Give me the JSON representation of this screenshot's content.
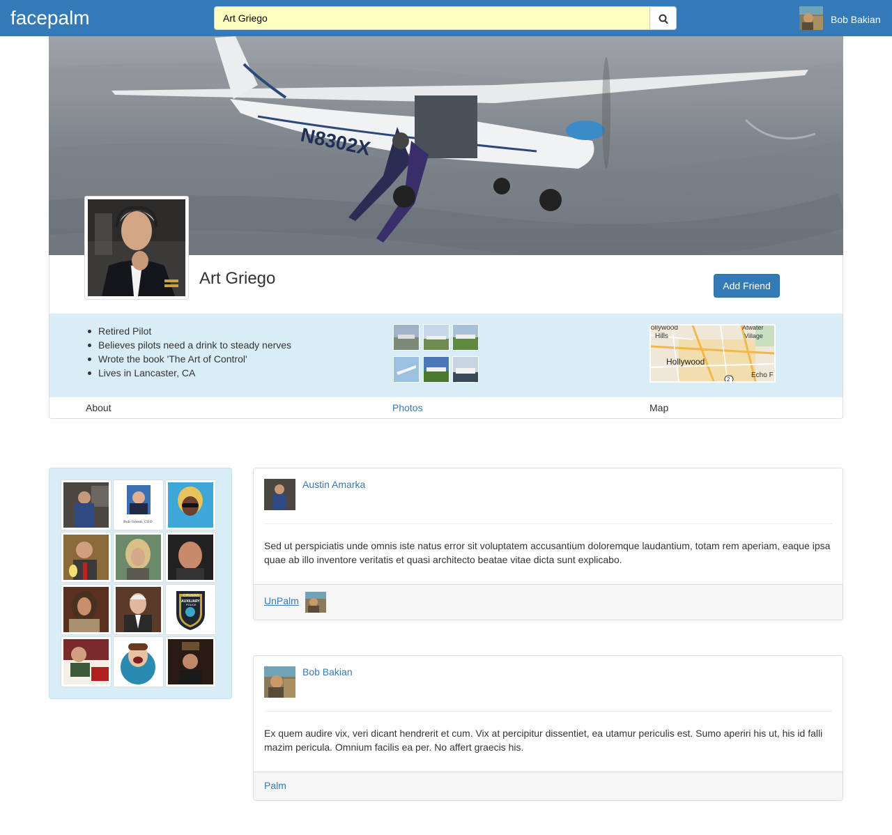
{
  "navbar": {
    "brand": "facepalm",
    "search": {
      "value": "Art Griego",
      "icon": "search-icon"
    },
    "user": {
      "name": "Bob Bakian",
      "avatar": "user-avatar"
    }
  },
  "profile": {
    "name": "Art Griego",
    "add_friend_label": "Add Friend",
    "about": [
      "Retired Pilot",
      "Believes pilots need a drink to steady nerves",
      "Wrote the book 'The Art of Control'",
      "Lives in Lancaster, CA"
    ],
    "map_labels": [
      "ollywood",
      "Hills",
      "Atwater",
      "Village",
      "Hollywood",
      "Echo F",
      "2"
    ],
    "tabs": [
      {
        "label": "About"
      },
      {
        "label": "Photos"
      },
      {
        "label": "Map"
      }
    ],
    "cover_text": "N8302X",
    "friends_badge_text": [
      "Bob Green, CEO",
      "CITIZENS",
      "AUXILIARY",
      "POLICE"
    ]
  },
  "posts": [
    {
      "author": "Austin Amarka",
      "body": "Sed ut perspiciatis unde omnis iste natus error sit voluptatem accusantium doloremque laudantium, totam rem aperiam, eaque ipsa quae ab illo inventore veritatis et quasi architecto beatae vitae dicta sunt explicabo.",
      "action": "UnPalm"
    },
    {
      "author": "Bob Bakian",
      "body": "Ex quem audire vix, veri dicant hendrerit et cum. Vix at percipitur dissentiet, ea utamur periculis est. Sumo aperiri his ut, his id falli mazim pericula. Omnium facilis ea per. No affert graecis his.",
      "action": "Palm"
    }
  ],
  "colors": {
    "navbar": "#337ab7",
    "link": "#337ab7",
    "search_bg": "#ffffc0",
    "info_band": "#d9edf7"
  }
}
